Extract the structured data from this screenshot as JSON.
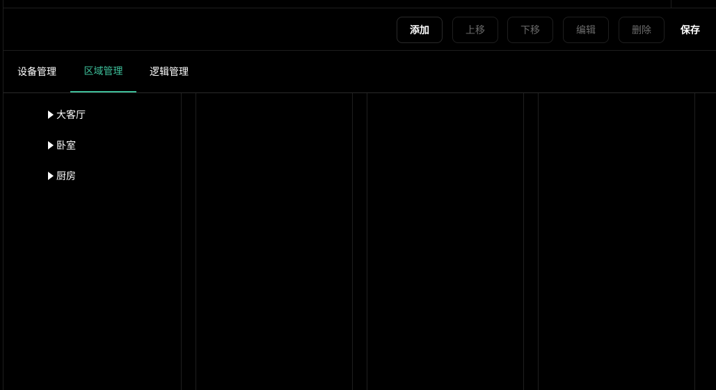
{
  "toolbar": {
    "add": "添加",
    "move_up": "上移",
    "move_down": "下移",
    "edit": "编辑",
    "delete": "删除",
    "save": "保存"
  },
  "tabs": [
    {
      "label": "设备管理",
      "active": false
    },
    {
      "label": "区域管理",
      "active": true
    },
    {
      "label": "逻辑管理",
      "active": false
    }
  ],
  "tree": [
    {
      "label": "大客厅",
      "expanded": false
    },
    {
      "label": "卧室",
      "expanded": false
    },
    {
      "label": "厨房",
      "expanded": false
    }
  ],
  "colors": {
    "accent": "#3dbf9a",
    "background": "#000000",
    "disabled_text": "#6c6c6c"
  }
}
